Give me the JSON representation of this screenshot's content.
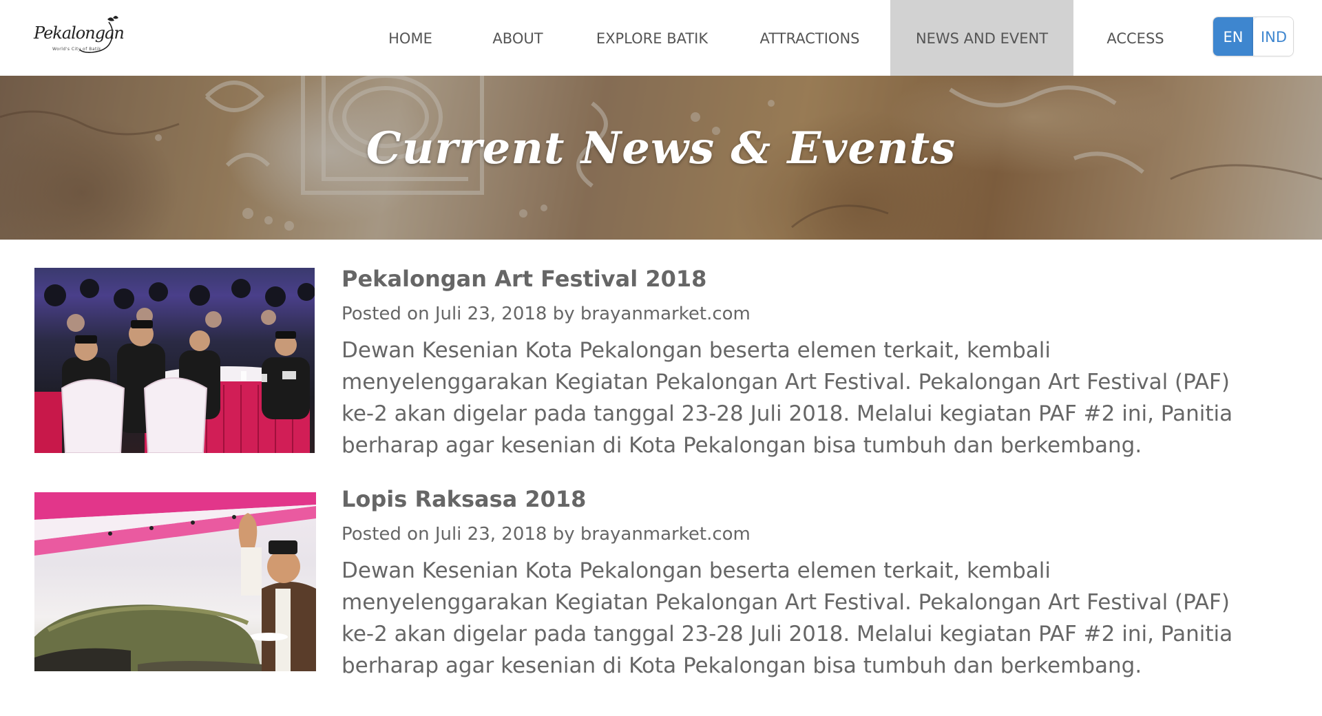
{
  "header": {
    "logo_text": "Pekalongan",
    "logo_tagline": "World's City of Batik",
    "nav": [
      {
        "label": "HOME",
        "active": false
      },
      {
        "label": "ABOUT",
        "active": false
      },
      {
        "label": "EXPLORE BATIK",
        "active": false
      },
      {
        "label": "ATTRACTIONS",
        "active": false
      },
      {
        "label": "NEWS AND EVENT",
        "active": true
      },
      {
        "label": "ACCESS",
        "active": false
      }
    ],
    "languages": [
      {
        "label": "EN",
        "active": true
      },
      {
        "label": "IND",
        "active": false
      }
    ]
  },
  "banner": {
    "title": "Current News & Events"
  },
  "posts": [
    {
      "title": "Pekalongan Art Festival 2018",
      "meta": "Posted on Juli 23, 2018 by brayanmarket.com",
      "excerpt": "Dewan Kesenian Kota Pekalongan beserta elemen terkait, kembali menyelenggarakan Kegiatan Pekalongan Art Festival. Pekalongan Art Festival (PAF) ke-2 akan digelar pada tanggal 23-28 Juli 2018.  Melalui kegiatan PAF #2 ini, Panitia berharap agar kesenian di Kota Pekalongan bisa tumbuh dan berkembang."
    },
    {
      "title": "Lopis Raksasa 2018",
      "meta": "Posted on Juli 23, 2018 by brayanmarket.com",
      "excerpt": "Dewan Kesenian Kota Pekalongan beserta elemen terkait, kembali menyelenggarakan Kegiatan Pekalongan Art Festival. Pekalongan Art Festival (PAF) ke-2 akan digelar pada tanggal 23-28 Juli 2018.  Melalui kegiatan PAF #2 ini, Panitia berharap agar kesenian di Kota Pekalongan bisa tumbuh dan berkembang."
    }
  ],
  "colors": {
    "active_nav_bg": "#d2d2d2",
    "lang_active": "#3e86cf",
    "text": "#666666"
  }
}
